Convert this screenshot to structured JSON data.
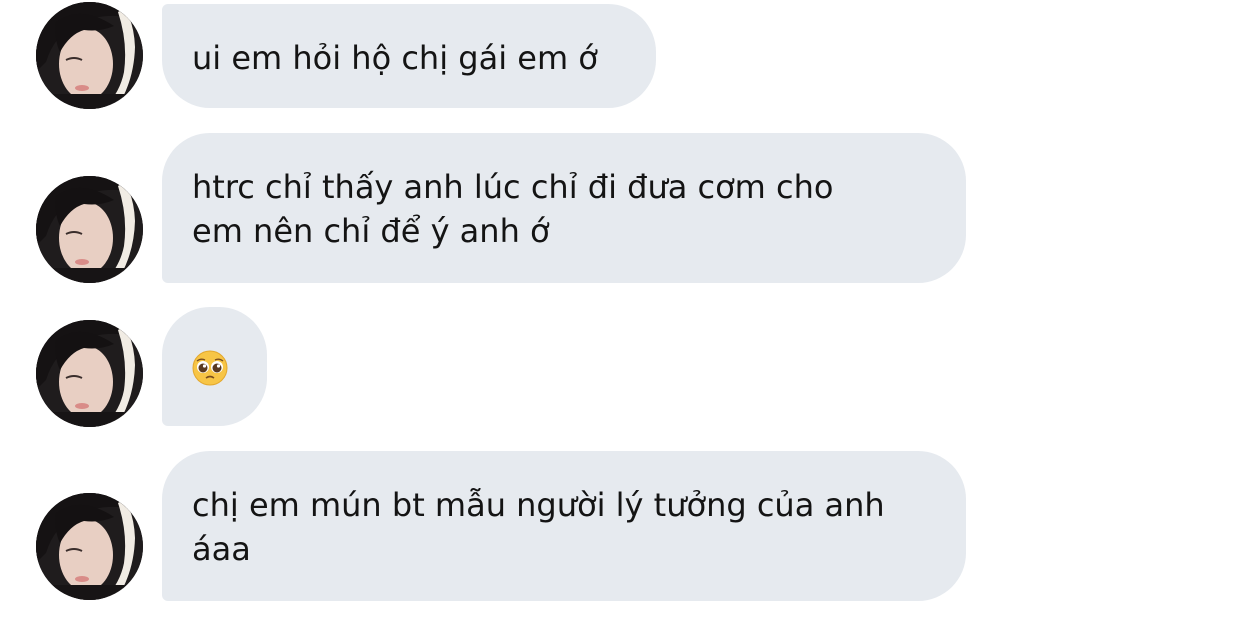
{
  "messages": [
    {
      "lines": [
        "ui em hỏi hộ chị gái em ớ"
      ]
    },
    {
      "lines": [
        "htrc chỉ thấy anh lúc chỉ đi đưa cơm cho",
        "em nên chỉ để ý anh ớ"
      ]
    },
    {
      "emoji": "pleading-face-emoji"
    },
    {
      "lines": [
        "chị em mún bt mẫu người lý tưởng của anh",
        "áaa"
      ]
    }
  ],
  "colors": {
    "bubble": "#e6eaef",
    "text": "#141414",
    "background": "#ffffff"
  }
}
